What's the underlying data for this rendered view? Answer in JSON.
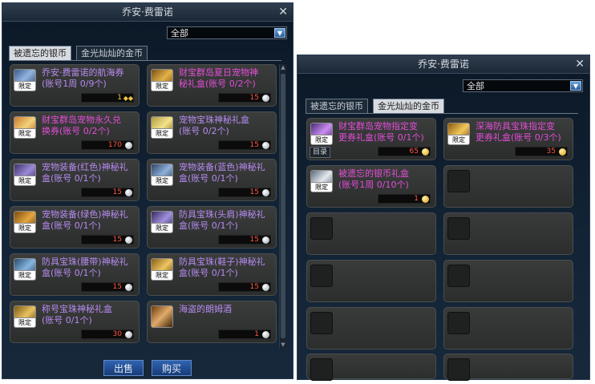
{
  "left": {
    "title": "乔安·费雷诺",
    "close_label": "✕",
    "filter": {
      "selected": "全部"
    },
    "tabs": [
      {
        "label": "被遗忘的银币"
      },
      {
        "label": "金光灿灿的金币"
      }
    ],
    "items": [
      {
        "name": "乔安·费雷诺的航海券\n(账号1周 0/9个)",
        "badge": "限定",
        "price": "1",
        "name_color": "purple",
        "price_color": "gold"
      },
      {
        "name": "财宝群岛夏日宠物神\n秘礼盒(账号 0/2个)",
        "badge": "限定",
        "price": "15",
        "name_color": "pink",
        "price_color": "red"
      },
      {
        "name": "财宝群岛宠物永久兑\n换券(账号 0/2个)",
        "badge": "限定",
        "price": "170",
        "name_color": "pink",
        "price_color": "red"
      },
      {
        "name": "宠物宝珠神秘礼盒\n(账号 0/2个)",
        "badge": "限定",
        "price": "15",
        "name_color": "purple",
        "price_color": "red"
      },
      {
        "name": "宠物装备(红色)神秘礼\n盒(账号 0/1个)",
        "badge": "限定",
        "price": "15",
        "name_color": "purple",
        "price_color": "red"
      },
      {
        "name": "宠物装备(蓝色)神秘礼\n盒(账号 0/1个)",
        "badge": "限定",
        "price": "15",
        "name_color": "purple",
        "price_color": "red"
      },
      {
        "name": "宠物装备(绿色)神秘礼\n盒(账号 0/1个)",
        "badge": "限定",
        "price": "15",
        "name_color": "purple",
        "price_color": "red"
      },
      {
        "name": "防具宝珠(头肩)神秘礼\n盒(账号 0/1个)",
        "badge": "限定",
        "price": "15",
        "name_color": "purple",
        "price_color": "red"
      },
      {
        "name": "防具宝珠(腰带)神秘礼\n盒(账号 0/1个)",
        "badge": "限定",
        "price": "15",
        "name_color": "purple",
        "price_color": "red"
      },
      {
        "name": "防具宝珠(鞋子)神秘礼\n盒(账号 0/1个)",
        "badge": "限定",
        "price": "15",
        "name_color": "purple",
        "price_color": "red"
      },
      {
        "name": "称号宝珠神秘礼盒\n(账号 0/1个)",
        "badge": "限定",
        "price": "30",
        "name_color": "purple",
        "price_color": "red"
      },
      {
        "name": "海盗的朗姆酒",
        "badge": "",
        "price": "1",
        "name_color": "purple",
        "price_color": "red"
      }
    ],
    "sell_label": "出售",
    "buy_label": "购买"
  },
  "right": {
    "title": "乔安·费雷诺",
    "close_label": "✕",
    "filter": {
      "selected": "全部"
    },
    "tabs": [
      {
        "label": "被遗忘的银币"
      },
      {
        "label": "金光灿灿的金币"
      }
    ],
    "items": [
      {
        "name": "财宝群岛宠物指定变\n更券礼盒(账号 0/1个)",
        "badge": "限定",
        "price": "65",
        "name_color": "pink",
        "price_color": "red",
        "tag": "目录"
      },
      {
        "name": "深海防具宝珠指定变\n更券礼盒(账号 0/3个)",
        "badge": "限定",
        "price": "35",
        "name_color": "pink",
        "price_color": "red"
      },
      {
        "name": "被遗忘的银币礼盒\n(账号1周 0/10个)",
        "badge": "限定",
        "price": "1",
        "name_color": "pink",
        "price_color": "red"
      }
    ]
  }
}
